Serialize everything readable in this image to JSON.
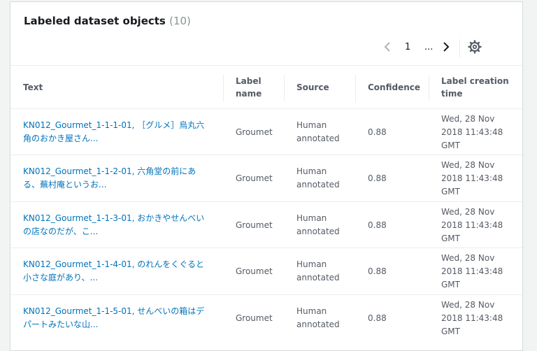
{
  "panel": {
    "title": "Labeled dataset objects",
    "count": "(10)"
  },
  "pagination": {
    "current_page": "1",
    "ellipsis": "...",
    "prev_icon": "chevron-left",
    "next_icon": "chevron-right",
    "settings_icon": "gear"
  },
  "columns": [
    "Text",
    "Label name",
    "Source",
    "Confidence",
    "Label creation time"
  ],
  "rows": [
    {
      "text": "KN012_Gourmet_1-1-1-01, ［グルメ］烏丸六角のおかき屋さん...",
      "label": "Groumet",
      "source": "Human annotated",
      "confidence": "0.88",
      "time": "Wed, 28 Nov 2018 11:43:48 GMT"
    },
    {
      "text": "KN012_Gourmet_1-1-2-01, 六角堂の前にある、蕪村庵というお...",
      "label": "Groumet",
      "source": "Human annotated",
      "confidence": "0.88",
      "time": "Wed, 28 Nov 2018 11:43:48 GMT"
    },
    {
      "text": "KN012_Gourmet_1-1-3-01, おかきやせんべいの店なのだが、こ...",
      "label": "Groumet",
      "source": "Human annotated",
      "confidence": "0.88",
      "time": "Wed, 28 Nov 2018 11:43:48 GMT"
    },
    {
      "text": "KN012_Gourmet_1-1-4-01, のれんをくぐると小さな庭があり、...",
      "label": "Groumet",
      "source": "Human annotated",
      "confidence": "0.88",
      "time": "Wed, 28 Nov 2018 11:43:48 GMT"
    },
    {
      "text": "KN012_Gourmet_1-1-5-01, せんべいの箱はデパートみたいな山...",
      "label": "Groumet",
      "source": "Human annotated",
      "confidence": "0.88",
      "time": "Wed, 28 Nov 2018 11:43:48 GMT"
    }
  ],
  "colors": {
    "link": "#0073bb",
    "header_text": "#545b64",
    "border": "#eaeded",
    "count": "#879596"
  }
}
